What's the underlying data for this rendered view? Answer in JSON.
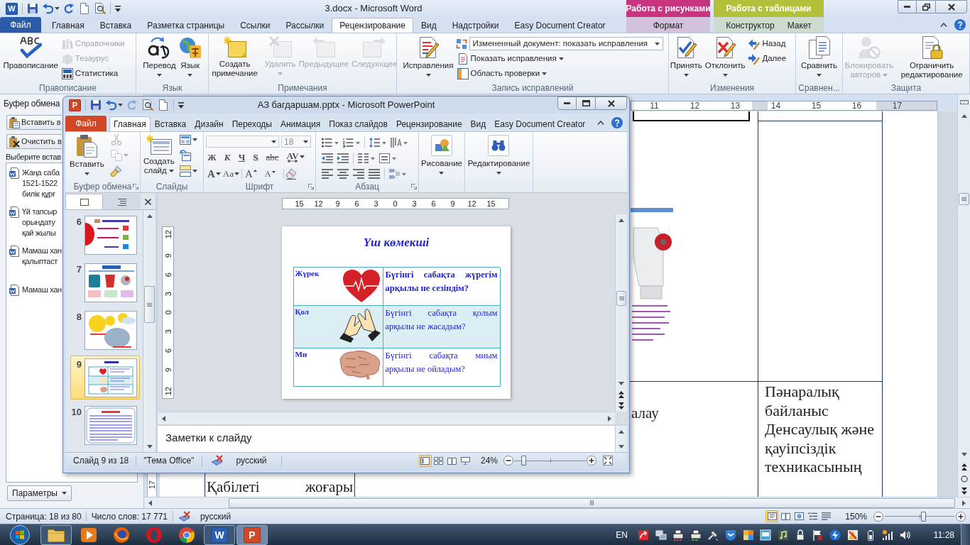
{
  "word": {
    "logo": "W",
    "title": "3.docx - Microsoft Word",
    "context_groups": [
      {
        "label": "Работа с рисунками",
        "color": "#c8357f",
        "tabs": [
          {
            "label": "Формат",
            "selected": false
          }
        ]
      },
      {
        "label": "Работа с таблицами",
        "color": "#b3c03a",
        "tabs": [
          {
            "label": "Конструктор",
            "selected": false
          },
          {
            "label": "Макет",
            "selected": false
          }
        ]
      }
    ],
    "tabs": [
      {
        "label": "Файл",
        "kind": "file",
        "selected": false
      },
      {
        "label": "Главная",
        "kind": "tab",
        "selected": false
      },
      {
        "label": "Вставка",
        "kind": "tab",
        "selected": false
      },
      {
        "label": "Разметка страницы",
        "kind": "tab",
        "selected": false
      },
      {
        "label": "Ссылки",
        "kind": "tab",
        "selected": false
      },
      {
        "label": "Рассылки",
        "kind": "tab",
        "selected": false
      },
      {
        "label": "Рецензирование",
        "kind": "tab",
        "selected": true
      },
      {
        "label": "Вид",
        "kind": "tab",
        "selected": false
      },
      {
        "label": "Надстройки",
        "kind": "tab",
        "selected": false
      },
      {
        "label": "Easy Document Creator",
        "kind": "tab",
        "selected": false
      }
    ],
    "ribbon": [
      {
        "label": "Правописание",
        "items": [
          {
            "kind": "large",
            "label": "Правописание",
            "menu": false,
            "disabled": false
          },
          {
            "kind": "small",
            "label": "Справочники",
            "menu": false,
            "disabled": true
          },
          {
            "kind": "small",
            "label": "Тезаурус",
            "menu": false,
            "disabled": true
          },
          {
            "kind": "small",
            "label": "Статистика",
            "menu": false,
            "disabled": false
          }
        ]
      },
      {
        "label": "Язык",
        "items": [
          {
            "kind": "large",
            "label": "Перевод",
            "menu": true,
            "disabled": false
          },
          {
            "kind": "large",
            "label": "Язык",
            "menu": true,
            "disabled": false
          }
        ]
      },
      {
        "label": "Примечания",
        "items": [
          {
            "kind": "large",
            "label": "Создать примечание",
            "menu": false,
            "disabled": false
          },
          {
            "kind": "large",
            "label": "Удалить",
            "menu": true,
            "disabled": true
          },
          {
            "kind": "large",
            "label": "Предыдущее",
            "menu": false,
            "disabled": true
          },
          {
            "kind": "large",
            "label": "Следующее",
            "menu": false,
            "disabled": true
          }
        ]
      },
      {
        "label": "Запись исправлений",
        "items": [
          {
            "kind": "large",
            "label": "Исправления",
            "menu": true,
            "disabled": false
          },
          {
            "kind": "combo",
            "label": "Измененный документ: показать исправления",
            "menu": true,
            "disabled": false
          },
          {
            "kind": "small",
            "label": "Показать исправления",
            "menu": true,
            "disabled": false
          },
          {
            "kind": "small",
            "label": "Область проверки",
            "menu": true,
            "disabled": false
          }
        ]
      },
      {
        "label": "Изменения",
        "items": [
          {
            "kind": "large",
            "label": "Принять",
            "menu": true,
            "disabled": false
          },
          {
            "kind": "large",
            "label": "Отклонить",
            "menu": true,
            "disabled": false
          },
          {
            "kind": "small",
            "label": "Назад",
            "menu": false,
            "disabled": false
          },
          {
            "kind": "small",
            "label": "Далее",
            "menu": false,
            "disabled": false
          }
        ]
      },
      {
        "label": "Сравнен...",
        "items": [
          {
            "kind": "large",
            "label": "Сравнить",
            "menu": true,
            "disabled": false
          }
        ]
      },
      {
        "label": "Защита",
        "items": [
          {
            "kind": "large",
            "label": "Блокировать авторов",
            "menu": true,
            "disabled": true
          },
          {
            "kind": "large",
            "label": "Ограничить редактирование",
            "menu": false,
            "disabled": false
          }
        ]
      }
    ],
    "clipboard_pane": {
      "title": "Буфер обмена",
      "buttons": [
        "Вставить в",
        "Очистить в"
      ],
      "hint": "Выберите встав",
      "items": [
        {
          "lines": [
            "Жаңа саба",
            "1521-1522",
            "билік құрғ"
          ]
        },
        {
          "lines": [
            "Үй тапсыр",
            "орындату",
            "қай жылы"
          ]
        },
        {
          "lines": [
            "Мамаш хан",
            "қалыптаст"
          ]
        },
        {
          "lines": [
            "Мамаш хан"
          ]
        }
      ],
      "options": "Параметры"
    },
    "ruler": [
      "11",
      "12",
      "13",
      "14",
      "15",
      "16",
      "17"
    ],
    "vertical_ruler": [
      "17"
    ],
    "document": {
      "row_2": {
        "column_1": "Қабілеті жоғары",
        "column_2": "алау",
        "column_3": "Пәнаралық байланыс Денсаулық және қауіпсіздік техникасының"
      }
    },
    "status_bar": {
      "page": "Страница: 18 из 80",
      "words": "Число слов: 17 771",
      "language": "русский",
      "views": [
        {
          "selected": true
        },
        {
          "selected": false
        },
        {
          "selected": false
        },
        {
          "selected": false
        },
        {
          "selected": false
        }
      ],
      "zoom": "150%",
      "zoom_slider": {
        "level": 0.55
      }
    }
  },
  "powerpoint": {
    "logo": "P",
    "title": "АЗ багдаршам.pptx - Microsoft PowerPoint",
    "tabs": [
      {
        "label": "Файл",
        "kind": "file",
        "selected": false
      },
      {
        "label": "Главная",
        "kind": "tab",
        "selected": true
      },
      {
        "label": "Вставка",
        "kind": "tab",
        "selected": false
      },
      {
        "label": "Дизайн",
        "kind": "tab",
        "selected": false
      },
      {
        "label": "Переходы",
        "kind": "tab",
        "selected": false
      },
      {
        "label": "Анимация",
        "kind": "tab",
        "selected": false
      },
      {
        "label": "Показ слайдов",
        "kind": "tab",
        "selected": false
      },
      {
        "label": "Рецензирование",
        "kind": "tab",
        "selected": false
      },
      {
        "label": "Вид",
        "kind": "tab",
        "selected": false
      },
      {
        "label": "Easy Document Creator",
        "kind": "tab",
        "selected": false
      }
    ],
    "ribbon": [
      {
        "kind": "clipboard",
        "label": "Буфер обмена",
        "launcher": true,
        "button": {
          "label": "Вставить",
          "menu": true
        },
        "tools": [
          {
            "disabled": true,
            "menu": false
          },
          {
            "disabled": true,
            "menu": true
          },
          {
            "disabled": false,
            "menu": false
          }
        ]
      },
      {
        "kind": "slides",
        "label": "Слайды",
        "launcher": false,
        "button": {
          "label": "Создать слайд",
          "menu": true
        },
        "tools": [
          {
            "disabled": false,
            "menu": true
          },
          {
            "disabled": false,
            "menu": false
          },
          {
            "disabled": false,
            "menu": true
          }
        ]
      },
      {
        "kind": "font",
        "label": "Шрифт",
        "launcher": true,
        "size": "18",
        "styles": [
          {
            "label": "Ж",
            "menu": false
          },
          {
            "label": "К",
            "menu": false
          },
          {
            "label": "Ч",
            "menu": false
          },
          {
            "label": "S",
            "menu": false
          },
          {
            "label": "abc",
            "menu": false
          },
          {
            "label": "AV",
            "menu": true
          }
        ],
        "sizing": [
          {
            "label": "A",
            "menu": true
          },
          {
            "label": "Aa",
            "menu": true
          },
          {
            "label": "A",
            "menu": false
          },
          {
            "label": "A",
            "menu": false
          }
        ]
      },
      {
        "kind": "paragraph",
        "label": "Абзац",
        "launcher": true
      },
      {
        "kind": "collapsed",
        "button": {
          "label": "Рисование",
          "menu": true
        }
      },
      {
        "kind": "collapsed",
        "button": {
          "label": "Редактирование",
          "menu": true
        }
      }
    ],
    "pane_tabs": [
      {
        "selected": true
      },
      {
        "selected": false
      }
    ],
    "thumbnails": [
      {
        "number": "6",
        "selected": false
      },
      {
        "number": "7",
        "selected": false
      },
      {
        "number": "8",
        "selected": false
      },
      {
        "number": "9",
        "selected": true
      },
      {
        "number": "10",
        "selected": false
      }
    ],
    "ruler": [
      "15",
      "12",
      "9",
      "6",
      "3",
      "0",
      "3",
      "6",
      "9",
      "12",
      "15"
    ],
    "vertical_ruler": [
      "12",
      "9",
      "6",
      "3",
      "0",
      "3",
      "6",
      "9",
      "12"
    ],
    "slide": {
      "title": "Үш көмекші",
      "rows": [
        {
          "label": "Жүрек",
          "text": "Бүгінгі сабақта жүрегім арқылы не сезіндім?",
          "bold": true,
          "shaded": false
        },
        {
          "label": "Қол",
          "text": "Бүгінгі сабақта қолым арқылы не жасадым?",
          "bold": false,
          "shaded": true
        },
        {
          "label": "Ми",
          "text": "Бүгінгі сабақта миым арқылы не ойладым?",
          "bold": false,
          "shaded": false
        }
      ]
    },
    "notes": {
      "placeholder": "Заметки к слайду"
    },
    "status_bar": {
      "slide": "Слайд 9 из 18",
      "theme": "\"Тема Office\"",
      "language": "русский",
      "views": [
        {
          "selected": true
        },
        {
          "selected": false
        },
        {
          "selected": false
        },
        {
          "selected": false
        }
      ],
      "zoom": "24%",
      "zoom_slider": {
        "level": 0.13
      }
    }
  },
  "taskbar": {
    "apps": [
      {
        "running": true,
        "selected": false
      },
      {
        "running": false,
        "selected": false
      },
      {
        "running": false,
        "selected": false
      },
      {
        "running": false,
        "selected": false
      },
      {
        "running": false,
        "selected": false
      },
      {
        "running": true,
        "selected": false,
        "letter": "W"
      },
      {
        "running": true,
        "selected": true,
        "letter": "P"
      }
    ],
    "language": "EN",
    "time": "11:28"
  }
}
